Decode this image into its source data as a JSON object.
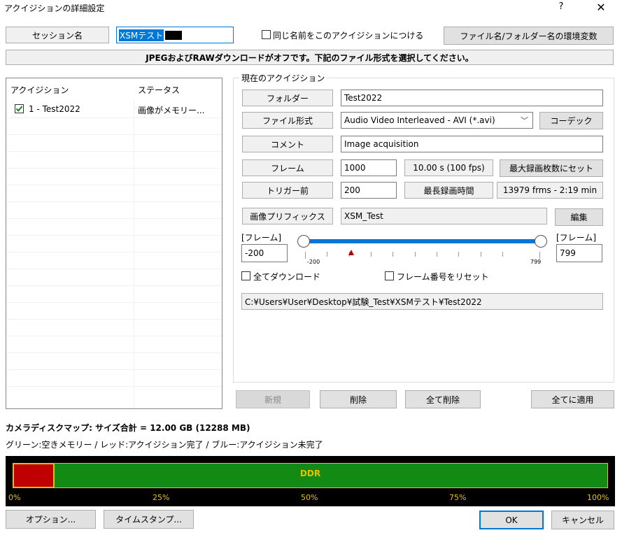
{
  "window": {
    "title": "アクイジションの詳細設定",
    "help": "?",
    "close": "✕"
  },
  "session": {
    "label": "セッション名",
    "value": "XSMテスト",
    "same_name_checkbox": "同じ名前をこのアクイジションにつける",
    "env_button": "ファイル名/フォルダー名の環境変数"
  },
  "banner": "JPEGおよびRAWダウンロードがオフです。下記のファイル形式を選択してください。",
  "list": {
    "col_acquisition": "アクイジション",
    "col_status": "ステータス",
    "rows": [
      {
        "name": "1 - Test2022",
        "status": "画像がメモリー..."
      }
    ]
  },
  "current": {
    "group_title": "現在のアクイジション",
    "folder_label": "フォルダー",
    "folder_value": "Test2022",
    "format_label": "ファイル形式",
    "format_value": "Audio Video Interleaved - AVI (*.avi)",
    "codec_button": "コーデック",
    "comment_label": "コメント",
    "comment_value": "Image acquisition",
    "frames_label": "フレーム",
    "frames_value": "1000",
    "frames_time": "10.00 s (100 fps)",
    "max_frames_button": "最大録画枚数にセット",
    "pretrigger_label": "トリガー前",
    "pretrigger_value": "200",
    "max_time_label": "最長録画時間",
    "max_time_value": "13979 frms - 2:19 min",
    "prefix_label": "画像プリフィックス",
    "prefix_value": "XSM_Test",
    "edit_button": "編集",
    "range_label_left": "[フレーム]",
    "range_label_right": "[フレーム]",
    "range_start": "-200",
    "range_end": "799",
    "slider_min_label": "-200",
    "slider_max_label": "799",
    "download_all": "全てダウンロード",
    "reset_frame_number": "フレーム番号をリセット",
    "path": "C:¥Users¥User¥Desktop¥試験_Test¥XSMテスト¥Test2022"
  },
  "actions": {
    "new": "新規",
    "delete": "削除",
    "delete_all": "全て削除",
    "apply_all": "全てに適用"
  },
  "diskmap": {
    "title": "カメラディスクマップ: サイズ合計 = 12.00 GB (12288 MB)",
    "legend": "グリーン:空きメモリー / レッド:アクイジション完了 / ブルー:アクイジション未完了",
    "bar_label": "DDR",
    "used_fraction": 0.07,
    "ticks": [
      "0%",
      "25%",
      "50%",
      "75%",
      "100%"
    ],
    "colors": {
      "free": "#138a13",
      "done": "#c00000",
      "border": "#e5c100",
      "tick_text": "#e5c100"
    }
  },
  "footer": {
    "options": "オプション...",
    "timestamp": "タイムスタンプ...",
    "ok": "OK",
    "cancel": "キャンセル"
  }
}
